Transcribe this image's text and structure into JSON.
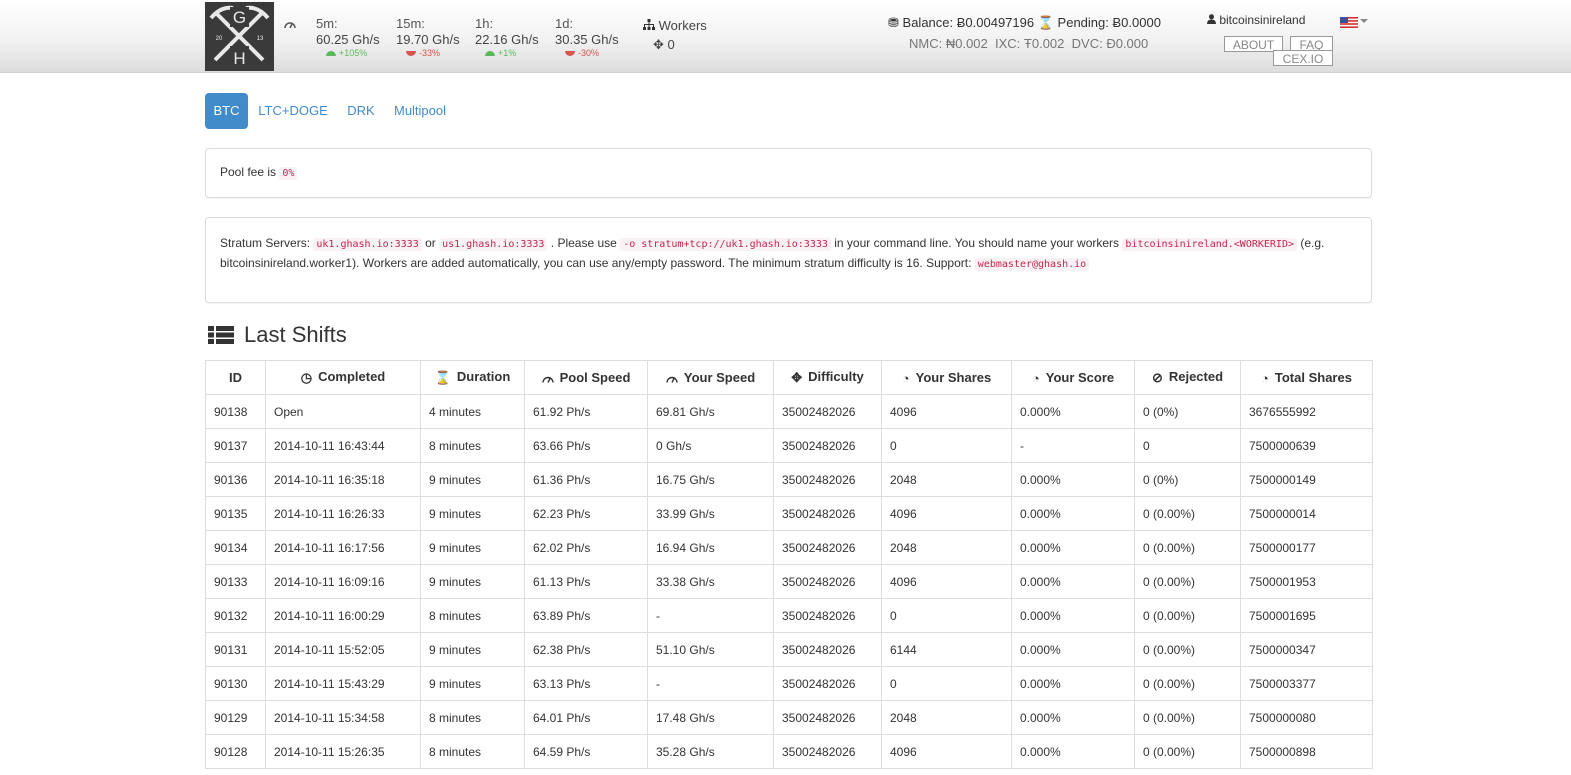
{
  "header": {
    "logo": {
      "letter_top": "G",
      "letter_bottom": "H",
      "year_left": "20",
      "year_right": "13"
    },
    "stats": [
      {
        "label": "5m:",
        "value": "60.25 Gh/s",
        "change": "+105%",
        "dir": "up"
      },
      {
        "label": "15m:",
        "value": "19.70 Gh/s",
        "change": "-33%",
        "dir": "down"
      },
      {
        "label": "1h:",
        "value": "22.16 Gh/s",
        "change": "+1%",
        "dir": "up"
      },
      {
        "label": "1d:",
        "value": "30.35 Gh/s",
        "change": "-30%",
        "dir": "down"
      }
    ],
    "workers": {
      "label": "Workers",
      "count": "0"
    },
    "balance": {
      "balance_label": "Balance:",
      "balance_value": "Ƀ0.00497196",
      "pending_label": "Pending:",
      "pending_value": "Ƀ0.0000"
    },
    "alt": {
      "nmc_label": "NMC:",
      "nmc_value": "₦0.002",
      "ixc_label": "IXC:",
      "ixc_value": "Ŧ0.002",
      "dvc_label": "DVC:",
      "dvc_value": "Ð0.000"
    },
    "username": "bitcoinsinireland",
    "buttons": {
      "about": "ABOUT",
      "faq": "FAQ",
      "cex": "CEX.IO"
    }
  },
  "tabs": [
    {
      "label": "BTC",
      "active": true
    },
    {
      "label": "LTC+DOGE",
      "active": false
    },
    {
      "label": "DRK",
      "active": false
    },
    {
      "label": "Multipool",
      "active": false
    }
  ],
  "fee": {
    "text": "Pool fee is",
    "value": "0%"
  },
  "stratum": {
    "label": "Stratum Servers:",
    "server1": "uk1.ghash.io:3333",
    "or": "or",
    "server2": "us1.ghash.io:3333",
    "please_use": ". Please use",
    "command": "-o stratum+tcp://uk1.ghash.io:3333",
    "after_command": "in your command line. You should name your workers",
    "worker_pattern": "bitcoinsinireland.<WORKERID>",
    "after_pattern": "(e.g. bitcoinsinireland.worker1). Workers are added automatically, you can use any/empty password. The minimum stratum difficulty is 16. Support:",
    "support_email": "webmaster@ghash.io"
  },
  "shifts": {
    "title": "Last Shifts",
    "columns": [
      "ID",
      "Completed",
      "Duration",
      "Pool Speed",
      "Your Speed",
      "Difficulty",
      "Your Shares",
      "Your Score",
      "Rejected",
      "Total Shares"
    ],
    "rows": [
      [
        "90138",
        "Open",
        "4 minutes",
        "61.92 Ph/s",
        "69.81 Gh/s",
        "35002482026",
        "4096",
        "0.000%",
        "0 (0%)",
        "3676555992"
      ],
      [
        "90137",
        "2014-10-11 16:43:44",
        "8 minutes",
        "63.66 Ph/s",
        "0 Gh/s",
        "35002482026",
        "0",
        "-",
        "0",
        "7500000639"
      ],
      [
        "90136",
        "2014-10-11 16:35:18",
        "9 minutes",
        "61.36 Ph/s",
        "16.75 Gh/s",
        "35002482026",
        "2048",
        "0.000%",
        "0 (0%)",
        "7500000149"
      ],
      [
        "90135",
        "2014-10-11 16:26:33",
        "9 minutes",
        "62.23 Ph/s",
        "33.99 Gh/s",
        "35002482026",
        "4096",
        "0.000%",
        "0 (0.00%)",
        "7500000014"
      ],
      [
        "90134",
        "2014-10-11 16:17:56",
        "9 minutes",
        "62.02 Ph/s",
        "16.94 Gh/s",
        "35002482026",
        "2048",
        "0.000%",
        "0 (0.00%)",
        "7500000177"
      ],
      [
        "90133",
        "2014-10-11 16:09:16",
        "9 minutes",
        "61.13 Ph/s",
        "33.38 Gh/s",
        "35002482026",
        "4096",
        "0.000%",
        "0 (0.00%)",
        "7500001953"
      ],
      [
        "90132",
        "2014-10-11 16:00:29",
        "8 minutes",
        "63.89 Ph/s",
        "-",
        "35002482026",
        "0",
        "0.000%",
        "0 (0.00%)",
        "7500001695"
      ],
      [
        "90131",
        "2014-10-11 15:52:05",
        "9 minutes",
        "62.38 Ph/s",
        "51.10 Gh/s",
        "35002482026",
        "6144",
        "0.000%",
        "0 (0.00%)",
        "7500000347"
      ],
      [
        "90130",
        "2014-10-11 15:43:29",
        "9 minutes",
        "63.13 Ph/s",
        "-",
        "35002482026",
        "0",
        "0.000%",
        "0 (0.00%)",
        "7500003377"
      ],
      [
        "90129",
        "2014-10-11 15:34:58",
        "8 minutes",
        "64.01 Ph/s",
        "17.48 Gh/s",
        "35002482026",
        "2048",
        "0.000%",
        "0 (0.00%)",
        "7500000080"
      ],
      [
        "90128",
        "2014-10-11 15:26:35",
        "8 minutes",
        "64.59 Ph/s",
        "35.28 Gh/s",
        "35002482026",
        "4096",
        "0.000%",
        "0 (0.00%)",
        "7500000898"
      ]
    ]
  }
}
